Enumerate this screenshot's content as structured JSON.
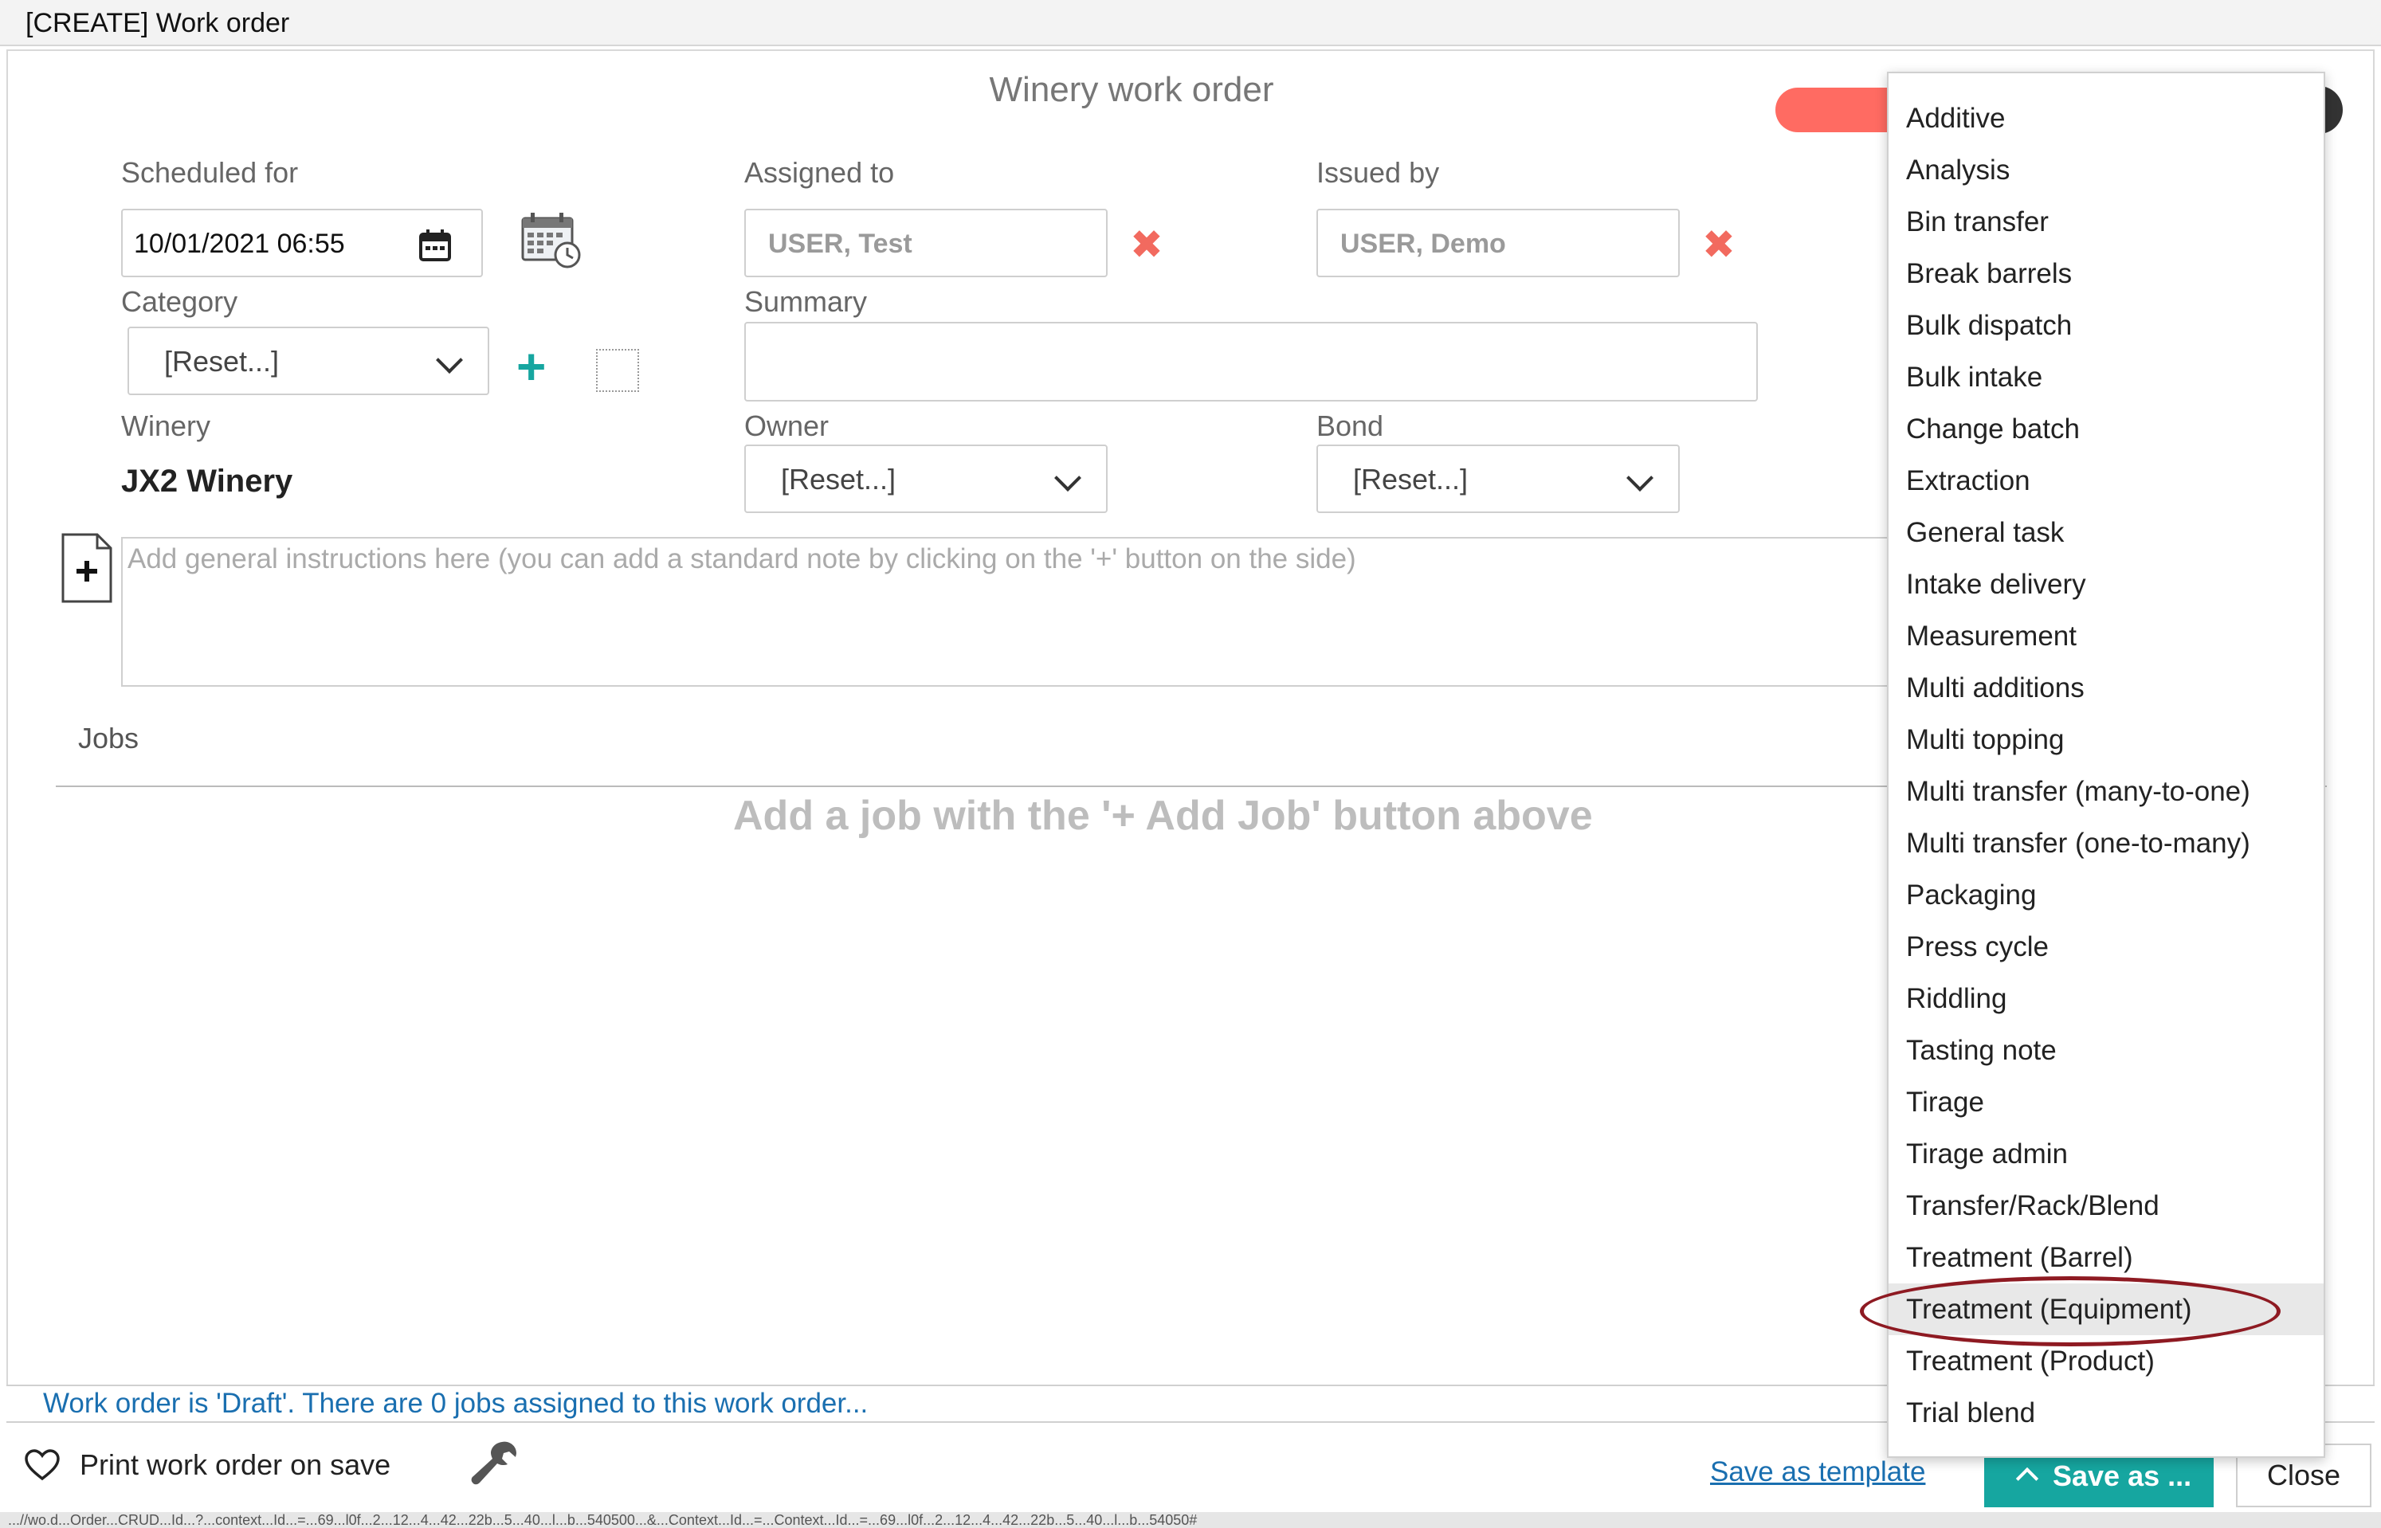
{
  "window": {
    "title": "[CREATE] Work order"
  },
  "form": {
    "title": "Winery work order",
    "scheduled_for": {
      "label": "Scheduled for",
      "value": "10/01/2021 06:55"
    },
    "assigned_to": {
      "label": "Assigned to",
      "value": "USER, Test"
    },
    "issued_by": {
      "label": "Issued by",
      "value": "USER, Demo"
    },
    "category": {
      "label": "Category",
      "value": "[Reset...]"
    },
    "summary": {
      "label": "Summary",
      "value": ""
    },
    "winery": {
      "label": "Winery",
      "value": "JX2 Winery"
    },
    "owner": {
      "label": "Owner",
      "value": "[Reset...]"
    },
    "bond": {
      "label": "Bond",
      "value": "[Reset...]"
    },
    "instructions_placeholder": "Add general instructions here (you can add a standard note by clicking on the '+' button on the side)"
  },
  "jobs": {
    "label": "Jobs",
    "empty_message": "Add a job with the '+ Add Job' button above"
  },
  "status": {
    "text": "Work order is 'Draft'. There are 0 jobs assigned to this work order..."
  },
  "footer": {
    "print_label": "Print work order on save",
    "save_template": "Save as template",
    "save_as": "Save as ...",
    "close": "Close",
    "url": "...//wo.d...Order...CRUD...Id...?...context...Id...=...69...l0f...2...12...4...42...22b...5...40...l...b...540500...&...Context...Id...=...Context...Id...=...69...l0f...2...12...4...42...22b...5...40...l...b...54050#"
  },
  "job_menu": {
    "items": [
      "Additive",
      "Analysis",
      "Bin transfer",
      "Break barrels",
      "Bulk dispatch",
      "Bulk intake",
      "Change batch",
      "Extraction",
      "General task",
      "Intake delivery",
      "Measurement",
      "Multi additions",
      "Multi topping",
      "Multi transfer (many-to-one)",
      "Multi transfer (one-to-many)",
      "Packaging",
      "Press cycle",
      "Riddling",
      "Tasting note",
      "Tirage",
      "Tirage admin",
      "Transfer/Rack/Blend",
      "Treatment (Barrel)",
      "Treatment (Equipment)",
      "Treatment (Product)",
      "Trial blend"
    ],
    "highlighted": "Treatment (Equipment)"
  },
  "colors": {
    "accent": "#16a6a0",
    "delete": "#f26a5f",
    "link": "#1a6fb0",
    "annotation": "#8e1a22"
  },
  "icons": {
    "calendar": "calendar-icon",
    "schedule": "calendar-clock-icon",
    "clear": "close-x-icon",
    "add": "plus-icon",
    "add_note": "add-document-icon",
    "print_toggle": "heart-icon",
    "tools": "wrench-icon"
  }
}
